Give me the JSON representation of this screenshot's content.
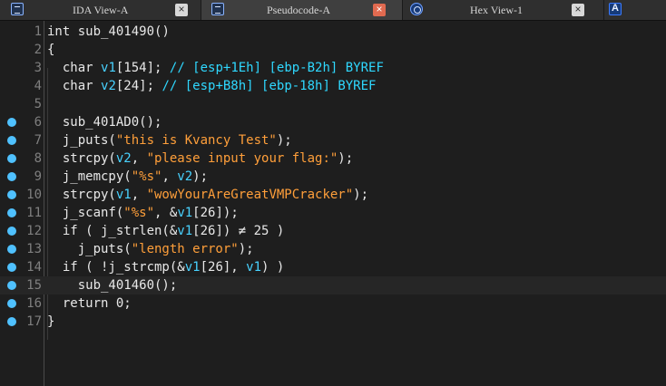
{
  "tabs": [
    {
      "label": "IDA View-A",
      "close": "×",
      "active": false
    },
    {
      "label": "Pseudocode-A",
      "close": "×",
      "active": true
    },
    {
      "label": "Hex View-1",
      "close": "×",
      "active": false
    }
  ],
  "lines": [
    {
      "num": "1",
      "text": "int sub_401490()",
      "breakpoint": false
    },
    {
      "num": "2",
      "text": "{",
      "breakpoint": false
    },
    {
      "num": "3",
      "text": "  char v1[154]; // [esp+1Eh] [ebp-B2h] BYREF",
      "breakpoint": false
    },
    {
      "num": "4",
      "text": "  char v2[24]; // [esp+B8h] [ebp-18h] BYREF",
      "breakpoint": false
    },
    {
      "num": "5",
      "text": "",
      "breakpoint": false
    },
    {
      "num": "6",
      "text": "  sub_401AD0();",
      "breakpoint": true
    },
    {
      "num": "7",
      "text": "  j_puts(\"this is Kvancy Test\");",
      "breakpoint": true
    },
    {
      "num": "8",
      "text": "  strcpy(v2, \"please input your flag:\");",
      "breakpoint": true
    },
    {
      "num": "9",
      "text": "  j_memcpy(\"%s\", v2);",
      "breakpoint": true
    },
    {
      "num": "10",
      "text": "  strcpy(v1, \"wowYourAreGreatVMPCracker\");",
      "breakpoint": true
    },
    {
      "num": "11",
      "text": "  j_scanf(\"%s\", &v1[26]);",
      "breakpoint": true
    },
    {
      "num": "12",
      "text": "  if ( j_strlen(&v1[26]) ≠ 25 )",
      "breakpoint": true
    },
    {
      "num": "13",
      "text": "    j_puts(\"length error\");",
      "breakpoint": true
    },
    {
      "num": "14",
      "text": "  if ( !j_strcmp(&v1[26], v1) )",
      "breakpoint": true
    },
    {
      "num": "15",
      "text": "    sub_401460();",
      "breakpoint": true
    },
    {
      "num": "16",
      "text": "  return 0;",
      "breakpoint": true
    },
    {
      "num": "17",
      "text": "}",
      "breakpoint": true
    }
  ],
  "current_line": "15",
  "colors": {
    "string": "#ff9f3a",
    "variable": "#48d2ff",
    "comment": "#2fd8ff",
    "breakpoint": "#4fc1ff"
  }
}
